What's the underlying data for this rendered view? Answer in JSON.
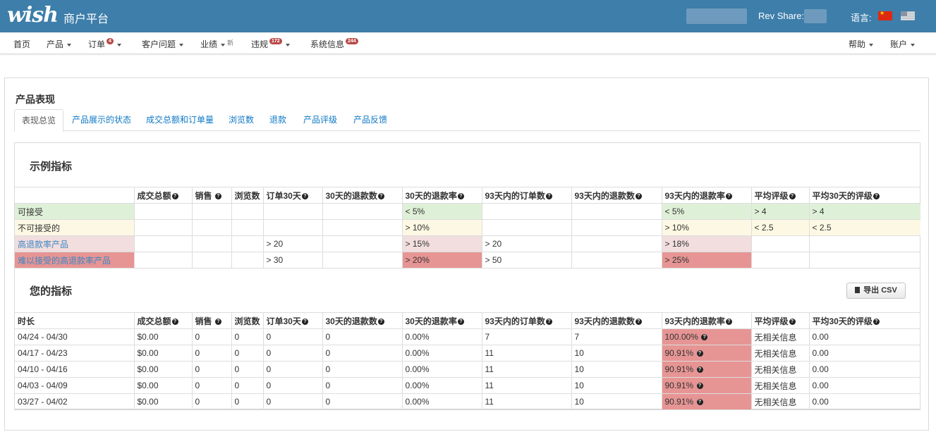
{
  "header": {
    "logo": "wish",
    "platform": "商户平台",
    "rev_share_label": "Rev Share:",
    "language_label": "语言:"
  },
  "nav": {
    "home": "首页",
    "products": "产品",
    "orders": "订单",
    "orders_badge": "4",
    "customer_issues": "客户问题",
    "performance": "业绩",
    "performance_new": "新",
    "violations": "违规",
    "violations_badge": "172",
    "system_info": "系统信息",
    "system_info_badge": "244",
    "help": "帮助",
    "account": "账户"
  },
  "page": {
    "title": "产品表现",
    "tabs": [
      "表现总览",
      "产品展示的状态",
      "成交总额和订单量",
      "浏览数",
      "退款",
      "产品评级",
      "产品反馈"
    ]
  },
  "example": {
    "title": "示例指标",
    "headers": [
      "",
      "成交总额",
      "销售 ",
      "浏览数 ",
      "订单30天",
      "30天的退款数",
      "30天的退款率",
      "93天内的订单数",
      "93天内的退款数",
      "93天内的退款率",
      "平均评级",
      "平均30天的评级"
    ],
    "rows": [
      [
        "可接受",
        "",
        "",
        "",
        "",
        "",
        "< 5%",
        "",
        "",
        "< 5%",
        "> 4",
        "> 4"
      ],
      [
        "不可接受的",
        "",
        "",
        "",
        "",
        "",
        "> 10%",
        "",
        "",
        "> 10%",
        "< 2.5",
        "< 2.5"
      ],
      [
        "高退款率产品",
        "",
        "",
        "",
        "> 20",
        "",
        "> 15%",
        "> 20",
        "",
        "> 18%",
        "",
        ""
      ],
      [
        "难以接受的高退款率产品",
        "",
        "",
        "",
        "> 30",
        "",
        "> 20%",
        "> 50",
        "",
        "> 25%",
        "",
        ""
      ]
    ]
  },
  "yours": {
    "title": "您的指标",
    "export_label": "导出 CSV",
    "headers": [
      "时长",
      "成交总额",
      "销售 ",
      "浏览数 ",
      "订单30天",
      "30天的退款数",
      "30天的退款率",
      "93天内的订单数",
      "93天内的退款数",
      "93天内的退款率",
      "平均评级",
      "平均30天的评级"
    ],
    "rows": [
      [
        "04/24 - 04/30",
        "$0.00",
        "0",
        "0",
        "0",
        "0",
        "0.00%",
        "7",
        "7",
        "100.00% ",
        "无相关信息",
        "0.00"
      ],
      [
        "04/17 - 04/23",
        "$0.00",
        "0",
        "0",
        "0",
        "0",
        "0.00%",
        "11",
        "10",
        "90.91% ",
        "无相关信息",
        "0.00"
      ],
      [
        "04/10 - 04/16",
        "$0.00",
        "0",
        "0",
        "0",
        "0",
        "0.00%",
        "11",
        "10",
        "90.91% ",
        "无相关信息",
        "0.00"
      ],
      [
        "04/03 - 04/09",
        "$0.00",
        "0",
        "0",
        "0",
        "0",
        "0.00%",
        "11",
        "10",
        "90.91% ",
        "无相关信息",
        "0.00"
      ],
      [
        "03/27 - 04/02",
        "$0.00",
        "0",
        "0",
        "0",
        "0",
        "0.00%",
        "11",
        "10",
        "90.91% ",
        "无相关信息",
        "0.00"
      ]
    ]
  },
  "colors": {
    "header_bg": "#3d7eaa",
    "acceptable": "#dff0d8",
    "unacceptable": "#fcf8e3",
    "high_refund": "#f2dede",
    "very_high_refund": "#e69594",
    "link": "#0e78c5"
  }
}
